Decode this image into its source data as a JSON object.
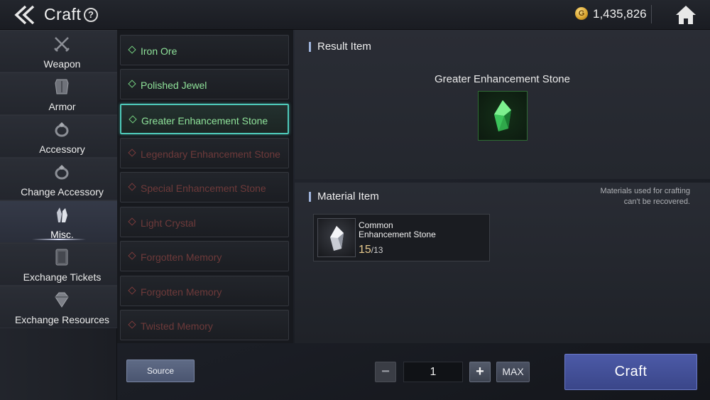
{
  "header": {
    "title": "Craft",
    "help_symbol": "?",
    "gold_symbol": "G",
    "gold_amount": "1,435,826"
  },
  "categories": [
    {
      "label": "Weapon",
      "icon": "crossed-swords-icon",
      "selected": false
    },
    {
      "label": "Armor",
      "icon": "armor-icon",
      "selected": false
    },
    {
      "label": "Accessory",
      "icon": "ring-icon",
      "selected": false
    },
    {
      "label": "Change Accessory",
      "icon": "ring-swap-icon",
      "selected": false
    },
    {
      "label": "Misc.",
      "icon": "crystal-icon",
      "selected": true
    },
    {
      "label": "Exchange Tickets",
      "icon": "ticket-icon",
      "selected": false
    },
    {
      "label": "Exchange Resources",
      "icon": "gem-icon",
      "selected": false
    }
  ],
  "recipes": [
    {
      "name": "Iron Ore",
      "state": "available"
    },
    {
      "name": "Polished Jewel",
      "state": "available"
    },
    {
      "name": "Greater Enhancement Stone",
      "state": "selected"
    },
    {
      "name": "Legendary Enhancement Stone",
      "state": "locked"
    },
    {
      "name": "Special Enhancement Stone",
      "state": "locked"
    },
    {
      "name": "Light Crystal",
      "state": "locked"
    },
    {
      "name": "Forgotten Memory",
      "state": "locked"
    },
    {
      "name": "Forgotten Memory",
      "state": "locked"
    },
    {
      "name": "Twisted Memory",
      "state": "locked"
    }
  ],
  "result": {
    "section_title": "Result Item",
    "item_name": "Greater Enhancement Stone",
    "item_icon": "green-crystal-icon"
  },
  "material": {
    "section_title": "Material Item",
    "note_line1": "Materials used for crafting",
    "note_line2": "can't be recovered.",
    "item_name_line1": "Common",
    "item_name_line2": "Enhancement Stone",
    "item_icon": "white-crystal-icon",
    "owned": "15",
    "required": "/13"
  },
  "footer": {
    "source_label": "Source",
    "minus_label": "−",
    "plus_label": "+",
    "quantity": "1",
    "max_label": "MAX",
    "craft_label": "Craft"
  },
  "colors": {
    "available_text": "#8fe39a",
    "locked_text": "#6e3a3a",
    "selected_border": "#4ec9b9",
    "craft_button": "#4551a0",
    "owned_count": "#e7c98d"
  }
}
